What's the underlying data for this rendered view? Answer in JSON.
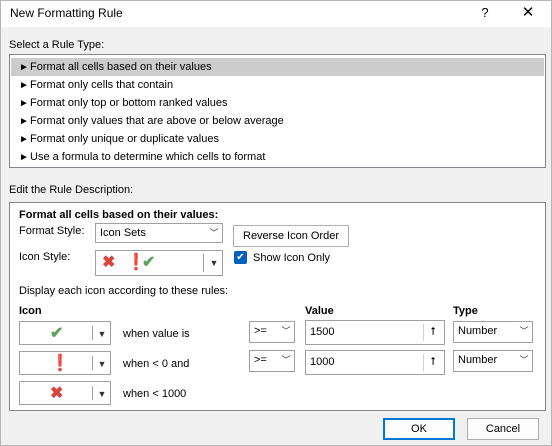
{
  "window": {
    "title": "New Formatting Rule",
    "help_glyph": "?",
    "close_glyph": "✕"
  },
  "rule_type": {
    "label": "Select a Rule Type:",
    "items": [
      {
        "label": "Format all cells based on their values"
      },
      {
        "label": "Format only cells that contain"
      },
      {
        "label": "Format only top or bottom ranked values"
      },
      {
        "label": "Format only values that are above or below average"
      },
      {
        "label": "Format only unique or duplicate values"
      },
      {
        "label": "Use a formula to determine which cells to format"
      }
    ],
    "selected_index": 0
  },
  "description": {
    "label": "Edit the Rule Description:",
    "heading": "Format all cells based on their values:",
    "format_style_label": "Format Style:",
    "format_style_value": "Icon Sets",
    "reverse_button": "Reverse Icon Order",
    "icon_style_label": "Icon Style:",
    "show_icon_only_label": "Show Icon Only",
    "show_icon_only_checked": true,
    "rules_label": "Display each icon according to these rules:",
    "col_icon": "Icon",
    "col_value": "Value",
    "col_type": "Type",
    "rows": [
      {
        "icon": "green-check",
        "when": "when value is",
        "op": ">=",
        "value": "1500",
        "type": "Number"
      },
      {
        "icon": "yellow-exclamation",
        "when": "when < 0 and",
        "op": ">=",
        "value": "1000",
        "type": "Number"
      },
      {
        "icon": "red-x",
        "when": "when < 1000"
      }
    ]
  },
  "footer": {
    "ok": "OK",
    "cancel": "Cancel"
  },
  "colors": {
    "green": "#5fa35b",
    "yellow": "#e5a00d",
    "red": "#d9443d",
    "accent": "#005fb8"
  }
}
